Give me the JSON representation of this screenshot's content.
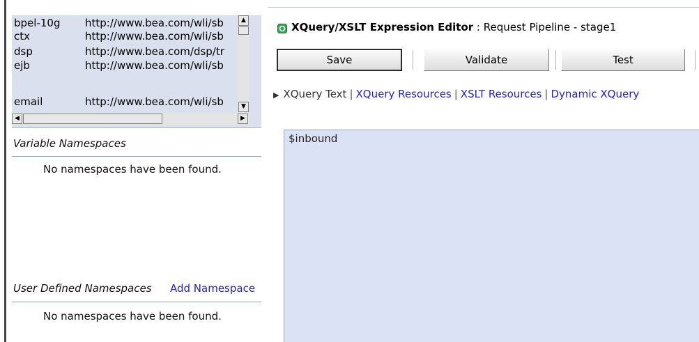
{
  "namespaces": [
    {
      "prefix": "bpel-10g",
      "uri": "http://www.bea.com/wli/sb"
    },
    {
      "prefix": "ctx",
      "uri": "http://www.bea.com/wli/sb"
    },
    {
      "prefix": "dsp",
      "uri": "http://www.bea.com/dsp/tr"
    },
    {
      "prefix": "ejb",
      "uri": "http://www.bea.com/wli/sb"
    },
    {
      "prefix": "email",
      "uri": "http://www.bea.com/wli/sb"
    }
  ],
  "variable_ns": {
    "title": "Variable Namespaces",
    "empty": "No namespaces have been found."
  },
  "user_ns": {
    "title": "User Defined Namespaces",
    "add_link": "Add Namespace",
    "empty": "No namespaces have been found."
  },
  "editor_header": {
    "title": "XQuery/XSLT Expression Editor",
    "subtitle": " : Request Pipeline - stage1"
  },
  "toolbar": {
    "save": "Save",
    "validate": "Validate",
    "test": "Test"
  },
  "tabs": {
    "marker": "▶",
    "items": [
      "XQuery Text",
      "XQuery Resources",
      "XSLT Resources",
      "Dynamic XQuery"
    ]
  },
  "editor": {
    "text": "$inbound"
  },
  "colors": {
    "panel_bg": "#dbe0ee",
    "editor_bg": "#dce2f6",
    "link": "#2323c8"
  }
}
